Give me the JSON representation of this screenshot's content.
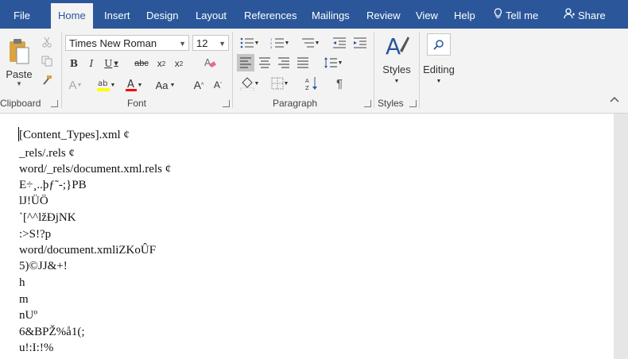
{
  "tabs": [
    {
      "label": "File",
      "name": "tab-file"
    },
    {
      "label": "Home",
      "name": "tab-home"
    },
    {
      "label": "Insert",
      "name": "tab-insert"
    },
    {
      "label": "Design",
      "name": "tab-design"
    },
    {
      "label": "Layout",
      "name": "tab-layout"
    },
    {
      "label": "References",
      "name": "tab-references"
    },
    {
      "label": "Mailings",
      "name": "tab-mailings"
    },
    {
      "label": "Review",
      "name": "tab-review"
    },
    {
      "label": "View",
      "name": "tab-view"
    },
    {
      "label": "Help",
      "name": "tab-help"
    }
  ],
  "tellme": {
    "label": "Tell me",
    "icon": "lightbulb-icon"
  },
  "share": {
    "label": "Share",
    "icon": "person-icon"
  },
  "clipboard": {
    "label": "Clipboard",
    "paste_label": "Paste"
  },
  "font": {
    "label": "Font",
    "family": "Times New Roman",
    "size": "12"
  },
  "paragraph": {
    "label": "Paragraph"
  },
  "styles": {
    "label": "Styles",
    "button_label": "Styles"
  },
  "editing": {
    "label": "Editing"
  },
  "document": {
    "lines": [
      "[Content_Types].xml ¢",
      "_rels/.rels ¢",
      "word/_rels/document.xml.rels ¢",
      "E÷¸..þƒ˜-;}PB",
      "lJ!ÜÖ",
      "`[^^lžÐjNK",
      ":>S!?p",
      "word/document.xmliZKoÛF",
      "5)©JJ&+!",
      "h",
      "m",
      "nUº",
      "6&BPŽ%å1(;",
      "u!:I:!%"
    ]
  },
  "colors": {
    "accent": "#2b579a",
    "ribbon": "#f3f3f3",
    "highlight": "#ffff00",
    "font_color": "#ff0000"
  }
}
